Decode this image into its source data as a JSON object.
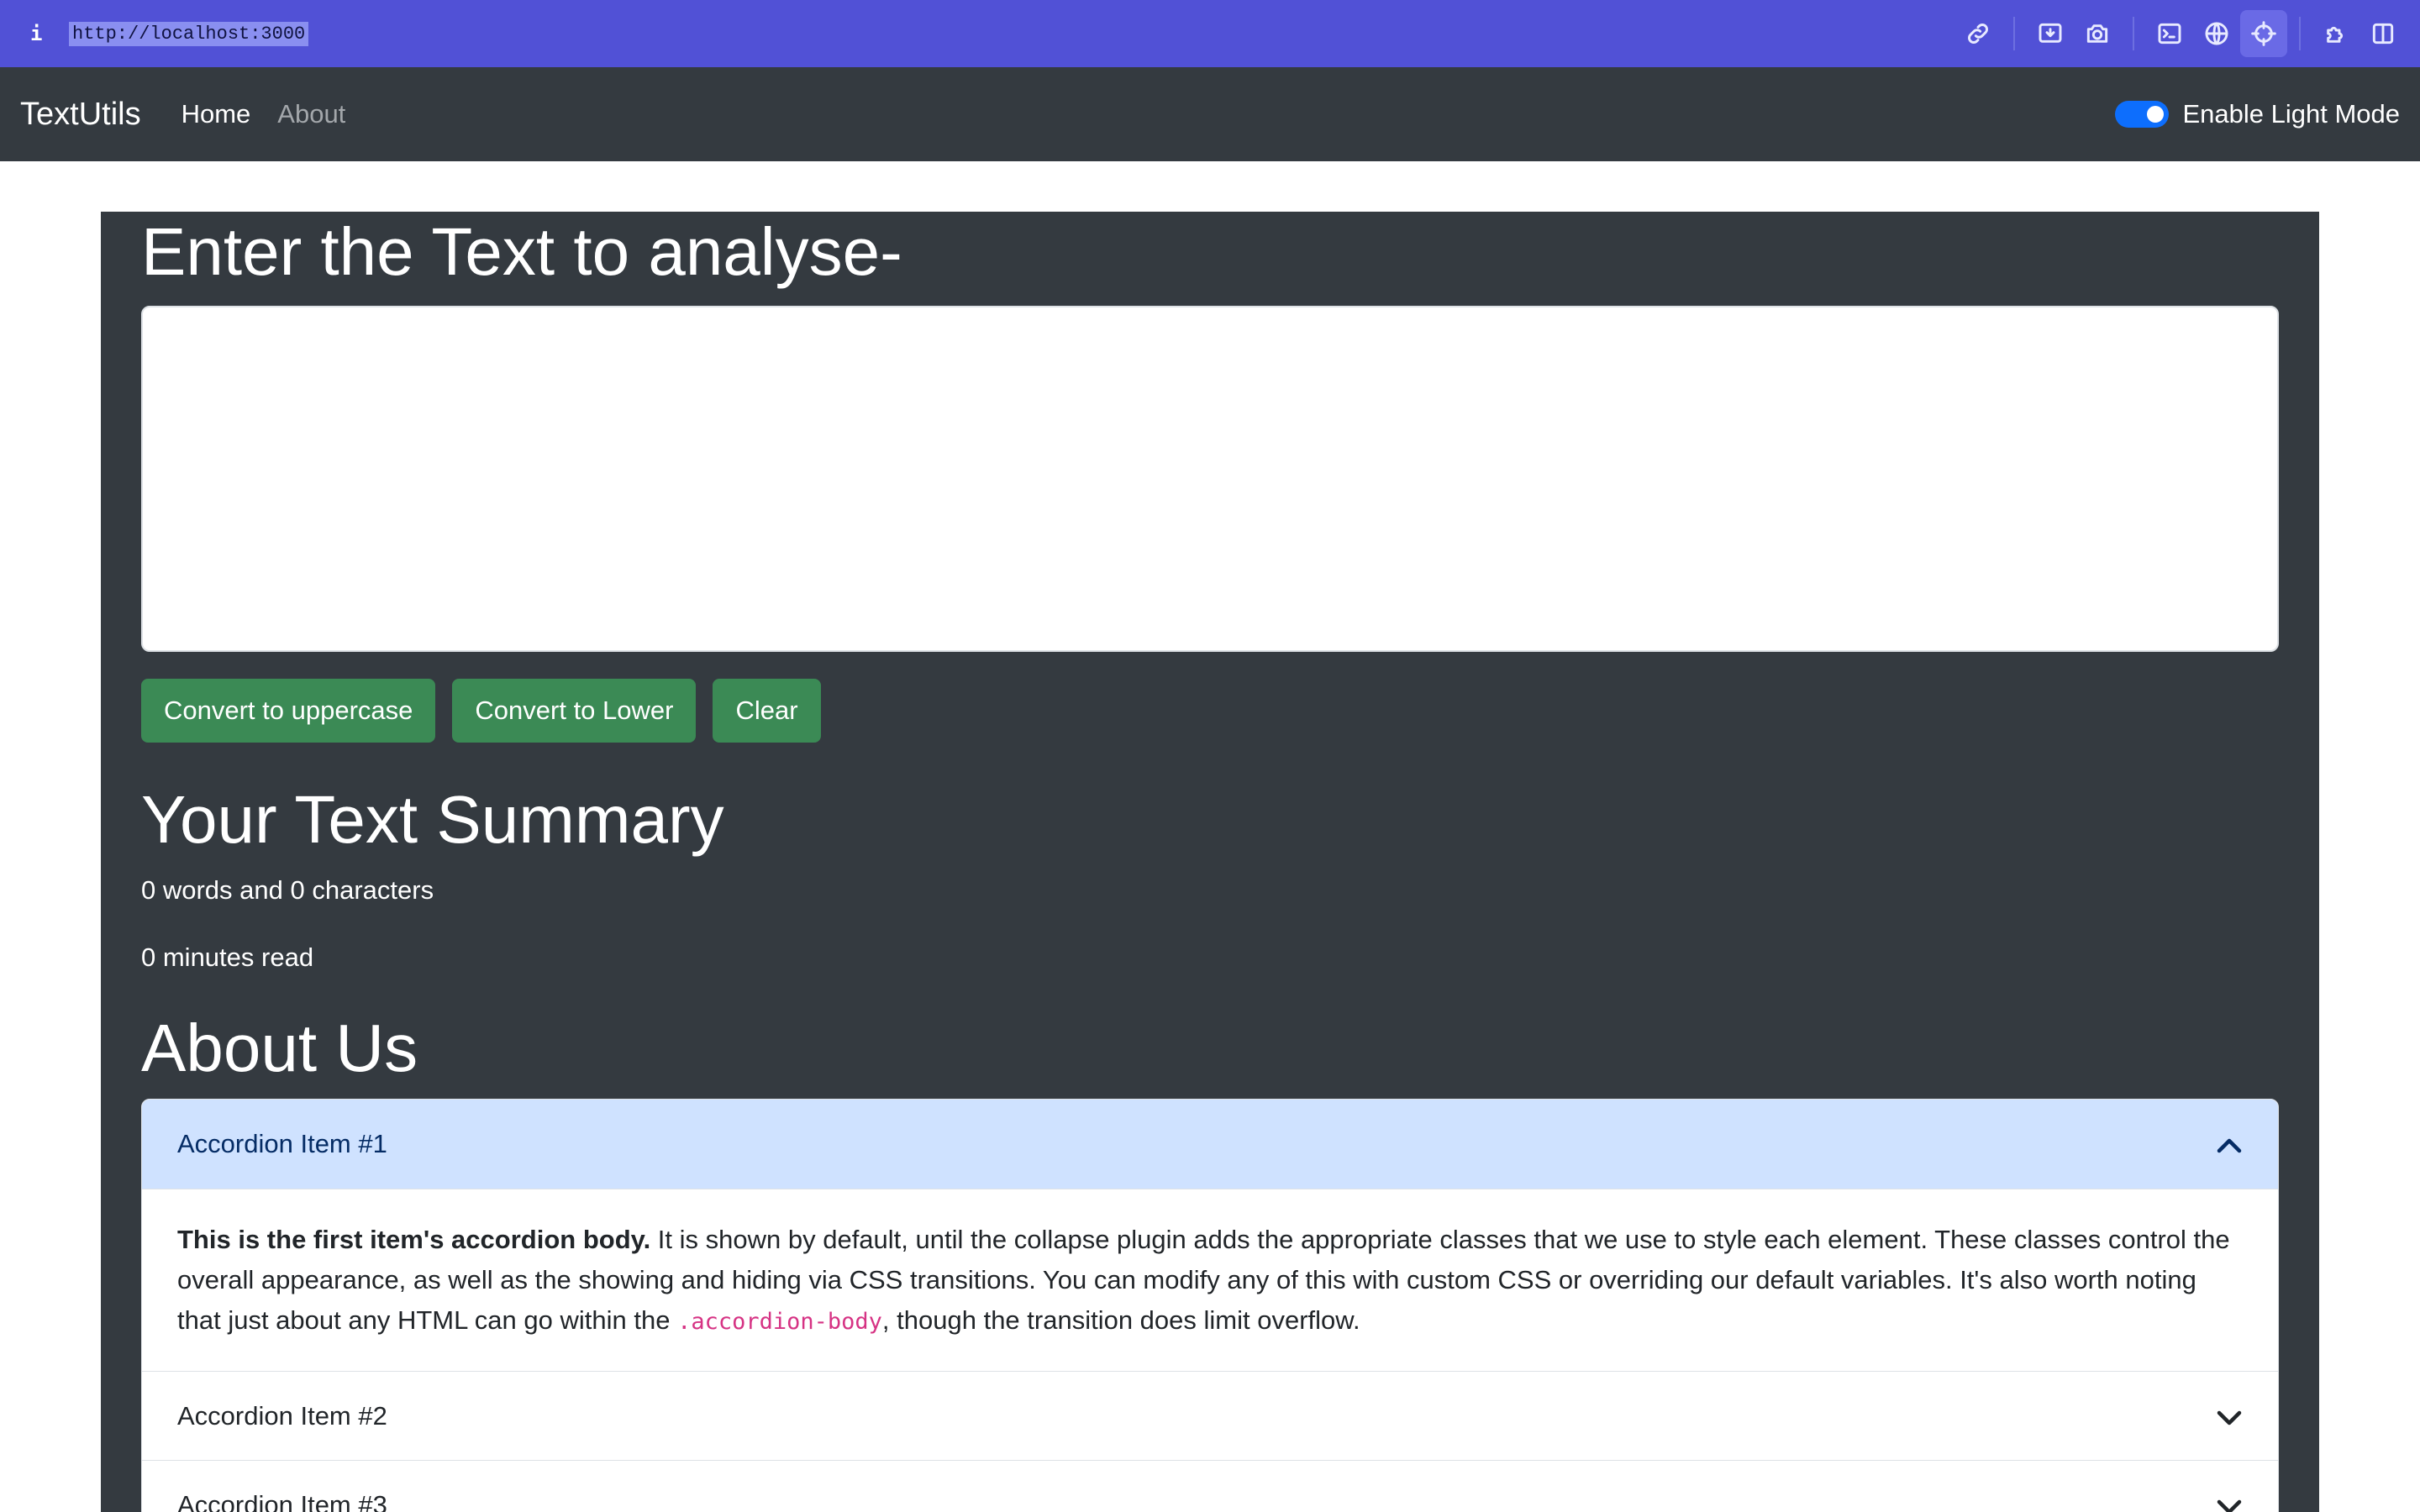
{
  "browser": {
    "info_glyph": "i",
    "url": "http://localhost:3000",
    "tools": [
      "link-icon",
      "download-icon",
      "camera-icon",
      "terminal-icon",
      "globe-icon",
      "crosshair-icon",
      "puzzle-icon",
      "sidebar-icon"
    ],
    "accent": "#5151d6"
  },
  "navbar": {
    "brand": "TextUtils",
    "links": [
      "Home",
      "About"
    ],
    "toggle_label": "Enable Light Mode",
    "toggle_on": true
  },
  "main": {
    "heading": "Enter the Text to analyse-",
    "textarea_value": "",
    "buttons": [
      "Convert to uppercase",
      "Convert to Lower",
      "Clear"
    ],
    "summary_heading": "Your Text Summary",
    "words_chars": "0 words and 0 characters",
    "read_time": "0 minutes read",
    "about_heading": "About Us"
  },
  "accordion": {
    "items": [
      {
        "title": "Accordion Item #1",
        "open": true
      },
      {
        "title": "Accordion Item #2",
        "open": false
      },
      {
        "title": "Accordion Item #3",
        "open": false
      }
    ],
    "body_bold": "This is the first item's accordion body.",
    "body_text_1": " It is shown by default, until the collapse plugin adds the appropriate classes that we use to style each element. These classes control the overall appearance, as well as the showing and hiding via CSS transitions. You can modify any of this with custom CSS or overriding our default variables. It's also worth noting that just about any HTML can go within the ",
    "body_code": ".accordion-body",
    "body_text_2": ", though the transition does limit overflow."
  },
  "colors": {
    "button_green": "#3b8a55",
    "dark_bg": "#343a40",
    "accordion_open_bg": "#cfe2ff",
    "code_pink": "#d63384"
  }
}
